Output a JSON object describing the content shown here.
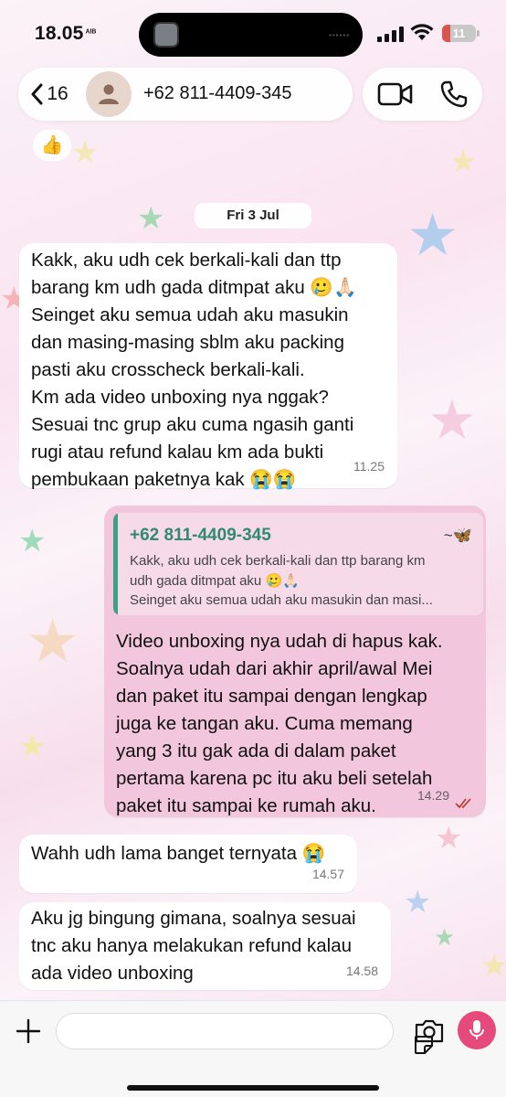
{
  "status_bar": {
    "time": "18.05",
    "time_suffix": "ᴬᴵᴮ",
    "battery": "11"
  },
  "header": {
    "back_count": "16",
    "back_icon": "chevron-left",
    "contact_name": "+62 811-4409-345",
    "avatar_icon": "person-silhouette",
    "video_icon": "video-camera",
    "call_icon": "phone"
  },
  "chat": {
    "reaction": "👍",
    "date_label": "Fri 3 Jul",
    "messages": [
      {
        "direction": "in",
        "text": "Kakk, aku udh cek berkali-kali dan ttp\nbarang km udh gada ditmpat aku 🥲🙏🏻\nSeinget aku semua udah aku masukin\ndan masing-masing sblm aku packing\npasti aku crosscheck berkali-kali.\nKm ada video unboxing nya nggak?\nSesuai tnc grup aku cuma ngasih ganti\nrugi atau refund kalau km ada bukti\npembukaan paketnya kak 😭😭",
        "time": "11.25"
      },
      {
        "direction": "out",
        "quote": {
          "name": "+62 811-4409-345",
          "suffix": "~🦋",
          "text": "Kakk, aku udh cek berkali-kali dan ttp barang km\nudh gada ditmpat aku 🥲🙏🏻\nSeinget aku semua udah aku masukin dan masi..."
        },
        "text": "Video unboxing nya udah di hapus kak.\nSoalnya udah dari akhir april/awal Mei\ndan paket itu sampai dengan lengkap\njuga ke tangan aku. Cuma memang\nyang 3 itu gak ada di dalam paket\npertama karena pc itu aku beli setelah\npaket itu sampai ke rumah aku.",
        "time": "14.29",
        "status": "read"
      },
      {
        "direction": "in",
        "text": "Wahh udh lama banget ternyata 😭",
        "time": "14.57"
      },
      {
        "direction": "in",
        "text": "Aku jg bingung gimana, soalnya sesuai\ntnc aku hanya melakukan refund kalau\nada video unboxing",
        "time": "14.58"
      }
    ]
  },
  "input_bar": {
    "placeholder": "",
    "plus_icon": "plus",
    "sticker_icon": "sticker",
    "camera_icon": "camera",
    "mic_icon": "microphone"
  },
  "colors": {
    "incoming_bubble": "#ffffff",
    "outgoing_bubble": "#f2c6dc",
    "quote_accent": "#3aa387",
    "mic_button": "#e64a7c",
    "read_ticks": "#c0392b"
  }
}
